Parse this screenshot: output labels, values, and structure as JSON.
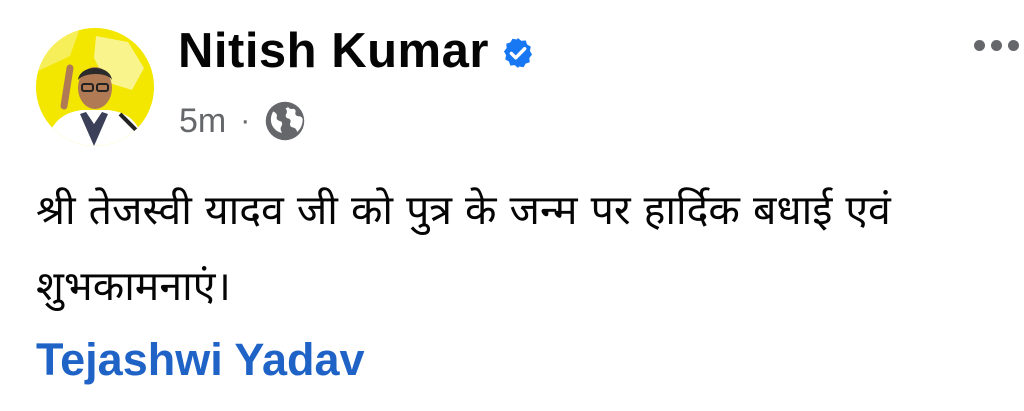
{
  "post": {
    "author": "Nitish Kumar",
    "verified_icon": "verified-badge-icon",
    "time": "5m",
    "separator": "·",
    "audience_icon": "globe-icon",
    "text": "श्री तेजस्वी यादव जी को पुत्र के जन्म पर हार्दिक बधाई एवं शुभकामनाएं।",
    "tag": "Tejashwi Yadav"
  },
  "colors": {
    "verified": "#1877f2",
    "tag_link": "#1f63c6",
    "meta": "#65676b",
    "avatar_bg": "#f3e700"
  }
}
